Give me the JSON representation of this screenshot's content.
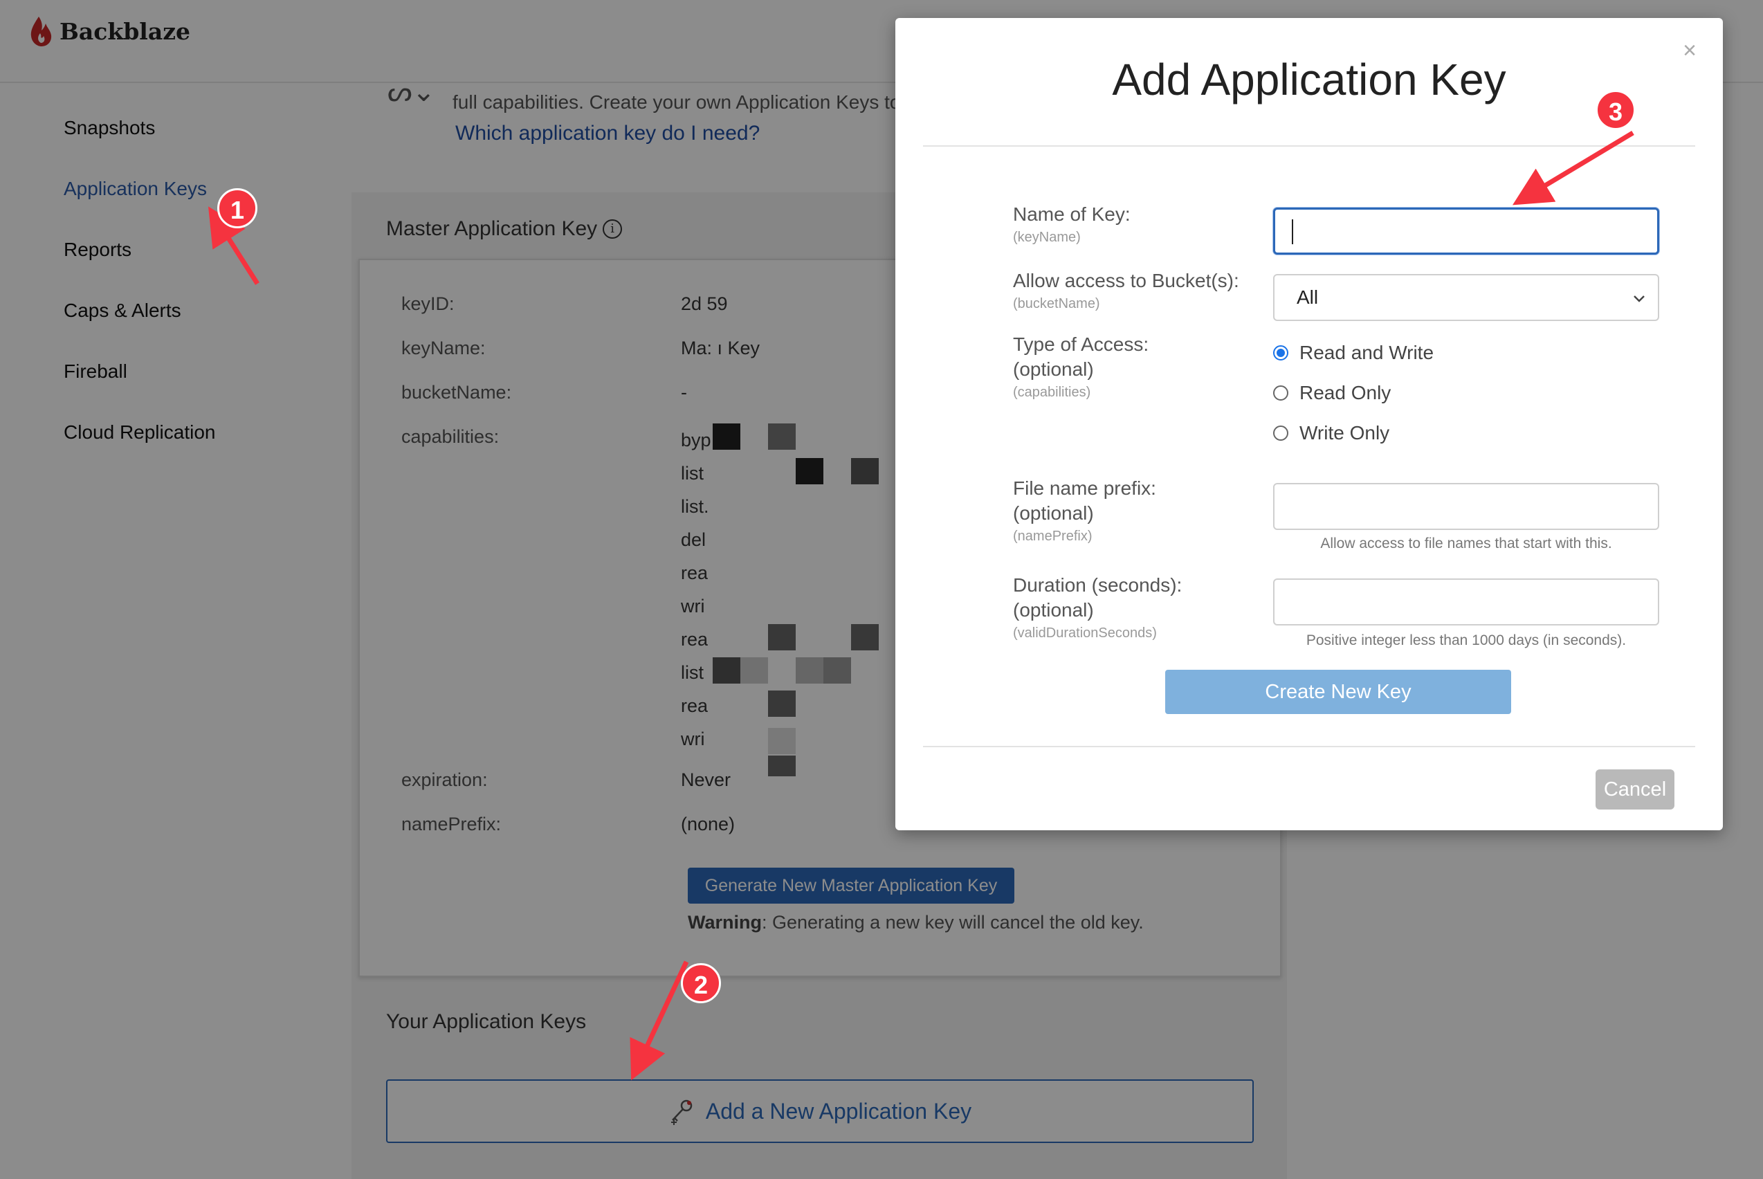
{
  "brand": {
    "name": "Backblaze",
    "logo_icon": "flame-icon",
    "color": "#c62828"
  },
  "sidebar": {
    "items": [
      {
        "label": "Snapshots",
        "active": false
      },
      {
        "label": "Application Keys",
        "active": true
      },
      {
        "label": "Reports",
        "active": false
      },
      {
        "label": "Caps & Alerts",
        "active": false
      },
      {
        "label": "Fireball",
        "active": false
      },
      {
        "label": "Cloud Replication",
        "active": false
      }
    ]
  },
  "intro": {
    "text": "full capabilities. Create your own Application Keys to",
    "link": "Which application key do I need?"
  },
  "master_key": {
    "title": "Master Application Key",
    "rows": [
      {
        "label": "keyID:",
        "value": "2d              59"
      },
      {
        "label": "keyName:",
        "value": "Ma:                     ı Key"
      },
      {
        "label": "bucketName:",
        "value": "-"
      },
      {
        "label": "capabilities:",
        "value": ""
      },
      {
        "label": "expiration:",
        "value": "Never"
      },
      {
        "label": "namePrefix:",
        "value": "(none)"
      }
    ],
    "capabilities": [
      "byp",
      "list",
      "list.",
      "del",
      "rea",
      "wri",
      "rea",
      "list",
      "rea",
      "wri"
    ],
    "generate_button": "Generate New Master Application Key",
    "warning_bold": "Warning",
    "warning_text": ": Generating a new key will cancel the old key."
  },
  "your_keys": {
    "title": "Your Application Keys",
    "add_button": "Add a New Application Key"
  },
  "modal": {
    "title": "Add Application Key",
    "close": "×",
    "fields": {
      "name_label": "Name of Key:",
      "name_sub": "(keyName)",
      "name_value": "",
      "bucket_label": "Allow access to Bucket(s):",
      "bucket_sub": "(bucketName)",
      "bucket_value": "All",
      "access_label": "Type of Access:",
      "access_label2": "(optional)",
      "access_sub": "(capabilities)",
      "access_options": [
        "Read and Write",
        "Read Only",
        "Write Only"
      ],
      "access_selected": "Read and Write",
      "prefix_label": "File name prefix:",
      "prefix_label2": "(optional)",
      "prefix_sub": "(namePrefix)",
      "prefix_value": "",
      "prefix_hint": "Allow access to file names that start with this.",
      "duration_label": "Duration (seconds):",
      "duration_label2": "(optional)",
      "duration_sub": "(validDurationSeconds)",
      "duration_value": "",
      "duration_hint": "Positive integer less than 1000 days (in seconds)."
    },
    "create_button": "Create New Key",
    "cancel_button": "Cancel"
  },
  "annotations": {
    "badges": [
      "1",
      "2",
      "3"
    ],
    "color": "#f5333f"
  },
  "colors": {
    "accent": "#2c68b8",
    "link": "#1f4ea3",
    "create_disabled": "#7fb1dd"
  }
}
